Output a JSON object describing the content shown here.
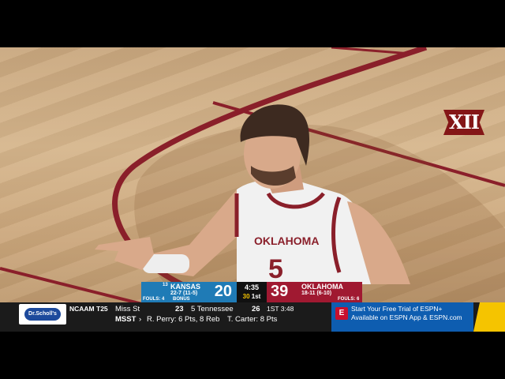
{
  "overlay": {
    "network_logo": "XII",
    "away": {
      "rank": "13",
      "name": "KANSAS",
      "record": "22-7 (11-5)",
      "score": "20",
      "fouls_label": "FOULS: 4",
      "bonus": "BONUS"
    },
    "home": {
      "name": "OKLAHOMA",
      "record": "18-11 (6-10)",
      "score": "39",
      "fouls_label": "FOULS: 6"
    },
    "clock": {
      "time": "4:35",
      "shot": "30",
      "period": "1st"
    }
  },
  "ticker": {
    "sponsor": "Dr.Scholl's",
    "label": "NCAAM T25",
    "team1": "Miss St",
    "score1": "23",
    "team2": "5 Tennessee",
    "score2": "26",
    "status": "1ST 3:48",
    "abbr": "MSST",
    "stat1": "R. Perry: 6 Pts, 8 Reb",
    "stat2": "T. Carter: 8 Pts",
    "promo_line1": "Start Your Free Trial of ESPN+",
    "promo_line2": "Available on ESPN App & ESPN.com"
  },
  "jersey": {
    "text": "OKLAHOMA",
    "number": "5"
  },
  "colors": {
    "kansas_blue": "#1f7bb6",
    "oklahoma_crimson": "#a01931",
    "espn_blue": "#0e5db0",
    "accent_yellow": "#f5c400"
  }
}
